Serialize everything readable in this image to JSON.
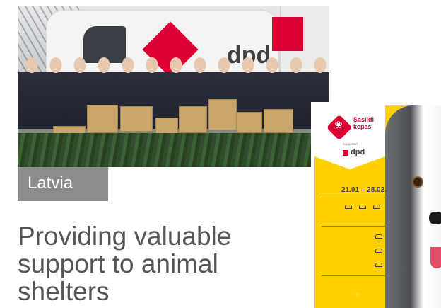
{
  "article": {
    "country": "Latvia",
    "headline_lines": [
      "Providing valuable",
      "support to animal",
      "shelters"
    ]
  },
  "photo": {
    "van_brand_text": "dpd"
  },
  "poster": {
    "campaign_lines": [
      "Sasildi",
      "kepas"
    ],
    "supported_by": "Supported",
    "brand": "dpd",
    "dates": "21.01 – 28.02."
  },
  "colors": {
    "label_bg": "#8c8c8c",
    "headline": "#555555",
    "dpd_red": "#dc0032",
    "poster_yellow": "#ffd100"
  },
  "icons": [
    "paw-icon",
    "heart-icon",
    "box-icon",
    "truck-icon",
    "send-icon"
  ]
}
